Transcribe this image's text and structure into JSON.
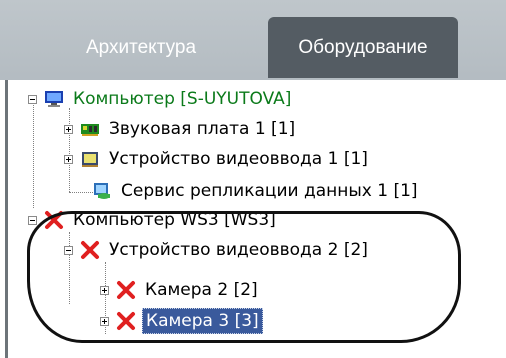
{
  "tabs": [
    {
      "label": "Архитектура",
      "active": false
    },
    {
      "label": "Оборудование",
      "active": true
    }
  ],
  "tree": [
    {
      "label": "Компьютер [S-UYUTOVA]",
      "icon": "computer-icon",
      "expanded": true,
      "color": "#0b7a1a"
    },
    {
      "label": "Звуковая плата 1 [1]",
      "icon": "sound-card-icon",
      "expanded": false
    },
    {
      "label": "Устройство видеоввода 1 [1]",
      "icon": "video-input-icon",
      "expanded": false
    },
    {
      "label": "Сервис репликации данных 1 [1]",
      "icon": "replication-service-icon"
    },
    {
      "label": "Компьютер WS3 [WS3]",
      "icon": "red-x-icon",
      "expanded": true
    },
    {
      "label": "Устройство видеоввода 2 [2]",
      "icon": "red-x-icon",
      "expanded": true
    },
    {
      "label": "Камера 2 [2]",
      "icon": "red-x-icon",
      "expanded": false
    },
    {
      "label": "Камера 3 [3]",
      "icon": "red-x-icon",
      "expanded": false,
      "selected": true
    }
  ],
  "colors": {
    "selection": "#3a5a9c",
    "error_icon": "#e02020",
    "tab_active": "#545c63"
  }
}
